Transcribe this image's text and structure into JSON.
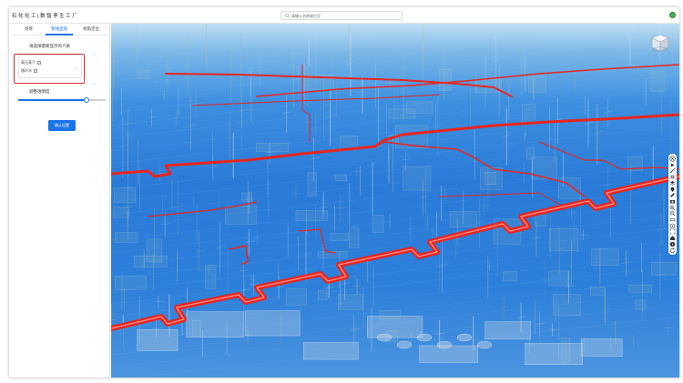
{
  "app": {
    "title": "石 化 化 工 | 数 智 孪 生 工 厂"
  },
  "search": {
    "placeholder": "请输入名称或位号"
  },
  "sidebar": {
    "tabs": [
      {
        "label": "场景",
        "active": false
      },
      {
        "label": "管线显隐",
        "active": true
      },
      {
        "label": "视角定位",
        "active": false
      }
    ],
    "more_label": "···",
    "panel_heading": "请选择需要显示的介质",
    "selected_tags": [
      "高压蒸汽",
      "循环水"
    ],
    "opacity_label": "调整透明度",
    "opacity_value": 0.78,
    "confirm_button": "确认设置"
  },
  "viewport": {
    "highlight_color": "#e8261e",
    "background_color": "#2a7bd8",
    "toolbar_icons": [
      "close-icon",
      "play-icon",
      "measure-icon",
      "settings-icon",
      "layers-icon",
      "location-icon",
      "edit-icon",
      "camera-icon",
      "zoom-in-icon",
      "zoom-out-icon",
      "ruler-icon",
      "target-icon",
      "fullscreen-icon",
      "home-icon",
      "info-icon",
      "refresh-icon"
    ]
  }
}
